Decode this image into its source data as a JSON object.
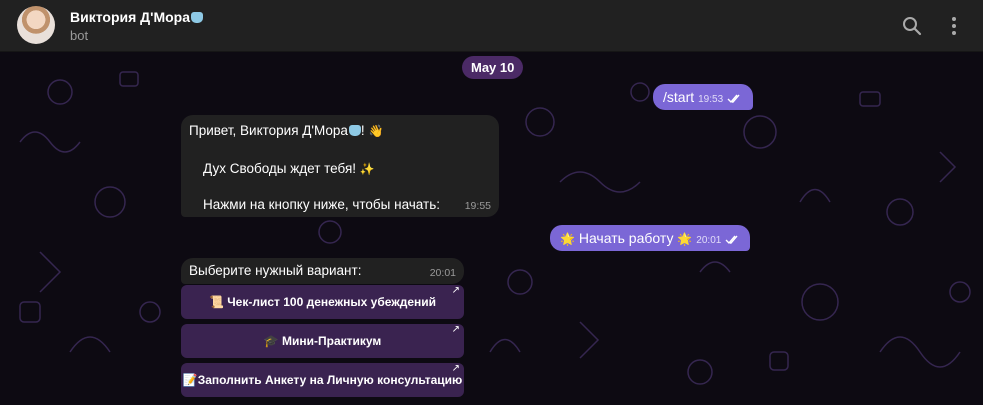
{
  "header": {
    "title": "Виктория Д'Мора",
    "subtitle": "bot"
  },
  "date_label": "May 10",
  "messages": {
    "start": {
      "text": "/start",
      "time": "19:53"
    },
    "greeting": {
      "line1": "Привет, Виктория Д'Мора",
      "line1_end": "!",
      "line2": "Дух Свободы ждет тебя!",
      "line3": "Нажми на кнопку ниже, чтобы начать:",
      "time": "19:55"
    },
    "start_work": {
      "text": "Начать работу",
      "time": "20:01"
    },
    "choose": {
      "text": "Выберите нужный вариант:",
      "time": "20:01"
    }
  },
  "keyboard": {
    "checklist": "Чек-лист 100 денежных убеждений",
    "mini": "Мини-Практикум",
    "form": "Заполнить Анкету на Личную консультацию",
    "arrow": "↗"
  },
  "emoji": {
    "wave": "👋",
    "sparkles": "✨",
    "star": "🌟",
    "scroll": "📜",
    "cap": "🎓",
    "memo": "📝"
  },
  "icons": {
    "search": "search-icon",
    "menu": "kebab-menu-icon",
    "read": "double-check-icon"
  },
  "colors": {
    "header": "#212121",
    "outgoing": "#7b67d6",
    "incoming": "#212121",
    "keyboard": "#3a2350",
    "date_pill": "#4b2a66"
  }
}
